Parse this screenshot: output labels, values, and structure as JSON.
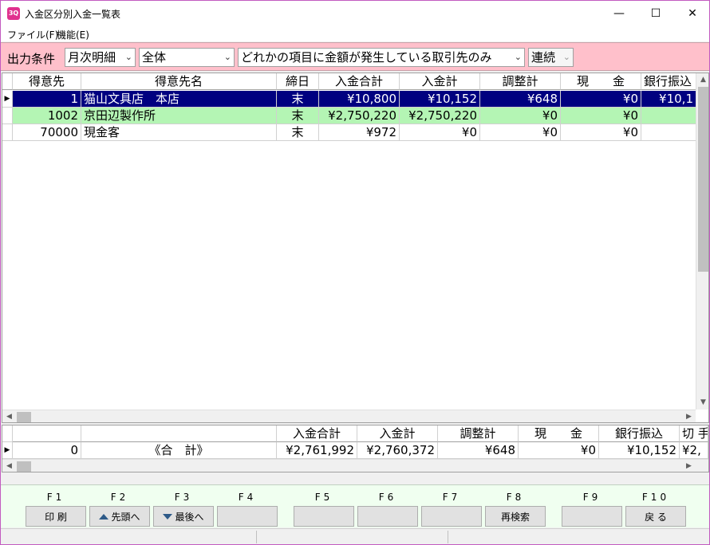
{
  "window": {
    "title": "入金区分別入金一覧表",
    "icon_text": "3Q"
  },
  "menu": {
    "file": "ファイル(F)",
    "function": "機能(E)"
  },
  "filter": {
    "label": "出力条件",
    "period": "月次明細",
    "scope": "全体",
    "condition": "どれかの項目に金額が発生している取引先のみ",
    "mode": "連続"
  },
  "grid": {
    "headers": [
      "得意先",
      "得意先名",
      "締日",
      "入金合計",
      "入金計",
      "調整計",
      "現　　金",
      "銀行振込"
    ],
    "rows": [
      {
        "code": "1",
        "name": "猫山文具店　本店",
        "close": "末",
        "total": "¥10,800",
        "nyukin": "¥10,152",
        "adjust": "¥648",
        "cash": "¥0",
        "bank": "¥10,1"
      },
      {
        "code": "1002",
        "name": "京田辺製作所",
        "close": "末",
        "total": "¥2,750,220",
        "nyukin": "¥2,750,220",
        "adjust": "¥0",
        "cash": "¥0",
        "bank": ""
      },
      {
        "code": "70000",
        "name": "現金客",
        "close": "末",
        "total": "¥972",
        "nyukin": "¥0",
        "adjust": "¥0",
        "cash": "¥0",
        "bank": ""
      }
    ]
  },
  "totals": {
    "headers": [
      "入金合計",
      "入金計",
      "調整計",
      "現　　金",
      "銀行振込",
      "切 手"
    ],
    "count": "0",
    "label": "《合　計》",
    "values": [
      "¥2,761,992",
      "¥2,760,372",
      "¥648",
      "¥0",
      "¥10,152",
      "¥2,"
    ]
  },
  "fkeys": [
    {
      "key": "F1",
      "label": "印 刷"
    },
    {
      "key": "F2",
      "label": "先頭へ"
    },
    {
      "key": "F3",
      "label": "最後へ"
    },
    {
      "key": "F4",
      "label": ""
    },
    {
      "key": "F5",
      "label": ""
    },
    {
      "key": "F6",
      "label": ""
    },
    {
      "key": "F7",
      "label": ""
    },
    {
      "key": "F8",
      "label": "再検索"
    },
    {
      "key": "F9",
      "label": ""
    },
    {
      "key": "F10",
      "label": "戻 る"
    }
  ],
  "colors": {
    "selected_row": "#000080",
    "alt_row": "#b4f5b4",
    "filter_bg": "#ffc0cb",
    "fkey_bg": "#f0fff0"
  }
}
